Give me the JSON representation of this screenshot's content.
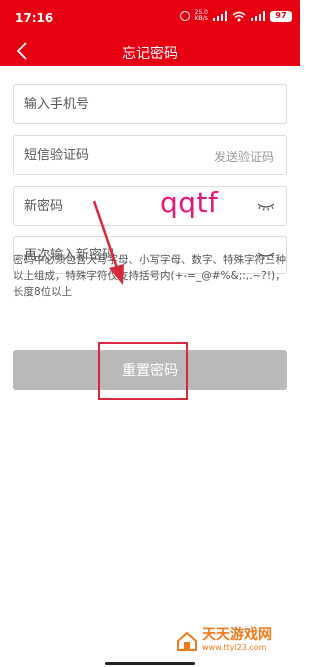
{
  "status_bar": {
    "time": "17:16",
    "net_speed": "25.0\nKB/s",
    "battery": "97"
  },
  "header": {
    "title": "忘记密码"
  },
  "form": {
    "phone_placeholder": "输入手机号",
    "code_placeholder": "短信验证码",
    "send_code_label": "发送验证码",
    "new_password_placeholder": "新密码",
    "confirm_password_placeholder": "再次输入新密码",
    "new_password_value": "",
    "confirm_password_value": ""
  },
  "annotation": {
    "text": "qqtf"
  },
  "hint": "密码中必须包含大写字母、小写字母、数字、特殊字符三种以上组成，特殊字符仅支持括号内(+-=_@#%&;:,.~?!)，长度8位以上",
  "reset_button_label": "重置密码",
  "watermark": {
    "brand": "天天游戏网",
    "url": "www.ttyl23.com"
  },
  "colors": {
    "brand_red": "#e60012",
    "disabled_button": "#b9b9b9",
    "annotation_pink": "#e8157a",
    "watermark_orange": "#f07a1a"
  }
}
